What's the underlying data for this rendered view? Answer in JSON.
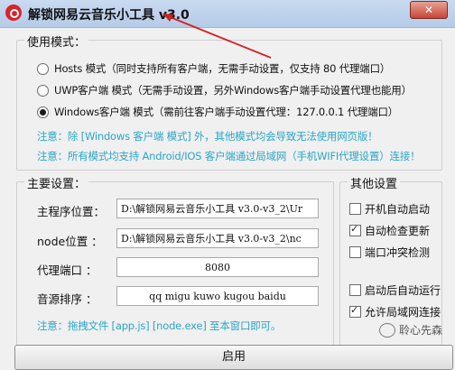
{
  "window": {
    "title": "解锁网易云音乐小工具 v3.0",
    "close_label": "✕"
  },
  "mode_group": {
    "legend": "使用模式：",
    "options": [
      {
        "label": "Hosts 模式（同时支持所有客户端，无需手动设置，仅支持 80 代理端口）",
        "checked": false
      },
      {
        "label": "UWP客户端 模式（无需手动设置，另外Windows客户端手动设置代理也能用）",
        "checked": false
      },
      {
        "label": "Windows客户端 模式（需前往客户端手动设置代理：127.0.0.1 代理端口）",
        "checked": true
      }
    ],
    "notes": [
      "注意：除 [Windows 客户端 模式] 外，其他模式均会导致无法使用网页版！",
      "注意：所有模式均支持 Android/IOS 客户端通过局域网（手机WIFI代理设置）连接！"
    ]
  },
  "main_group": {
    "legend": "主要设置：",
    "fields": [
      {
        "label": "主程序位置：",
        "value": "D:\\解锁网易云音乐小工具 v3.0-v3_2\\Ur"
      },
      {
        "label": "node位置  ：",
        "value": "D:\\解锁网易云音乐小工具 v3.0-v3_2\\nc"
      },
      {
        "label": "代理端口  ：",
        "value": "8080"
      },
      {
        "label": "音源排序  ：",
        "value": "qq migu kuwo kugou baidu"
      }
    ],
    "note": "注意：拖拽文件 [app.js] [node.exe] 至本窗口即可。"
  },
  "other_group": {
    "legend": "其他设置",
    "items": [
      {
        "label": "开机自动启动",
        "checked": false
      },
      {
        "label": "自动检查更新",
        "checked": true
      },
      {
        "label": "端口冲突检测",
        "checked": false
      },
      {
        "label": "启动后自动运行",
        "checked": false
      },
      {
        "label": "允许局域网连接",
        "checked": true
      }
    ]
  },
  "start_button": "启用",
  "watermark": "聆心先森"
}
